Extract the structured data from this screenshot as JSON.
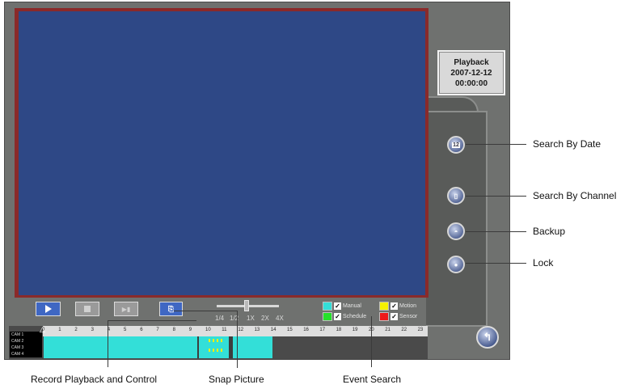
{
  "status": {
    "mode": "Playback",
    "date": "2007-12-12",
    "time": "00:00:00"
  },
  "right_buttons": [
    {
      "icon": "calendar-icon",
      "glyph": "12",
      "callout": "Search By Date"
    },
    {
      "icon": "channel-icon",
      "glyph": "▯",
      "callout": "Search By Channel"
    },
    {
      "icon": "backup-icon",
      "glyph": "◓",
      "callout": "Backup"
    },
    {
      "icon": "lock-icon",
      "glyph": "●",
      "callout": "Lock"
    }
  ],
  "speed_labels": [
    "1/4",
    "1/2",
    "1X",
    "2X",
    "4X"
  ],
  "legend": [
    {
      "label": "Manual",
      "color": "#33dfd8"
    },
    {
      "label": "Motion",
      "color": "#f5f000"
    },
    {
      "label": "Schedule",
      "color": "#25e02a"
    },
    {
      "label": "Sensor",
      "color": "#ee1a1a"
    }
  ],
  "timeline": {
    "hours": [
      "0",
      "1",
      "2",
      "3",
      "4",
      "5",
      "6",
      "7",
      "8",
      "9",
      "10",
      "11",
      "12",
      "13",
      "14",
      "15",
      "16",
      "17",
      "18",
      "19",
      "20",
      "21",
      "22",
      "23"
    ],
    "cameras": [
      "CAM 1",
      "CAM 2",
      "CAM 3",
      "CAM 4"
    ]
  },
  "callouts": {
    "record_playback": "Record Playback and Control",
    "snap_picture": "Snap Picture",
    "event_search": "Event Search"
  }
}
